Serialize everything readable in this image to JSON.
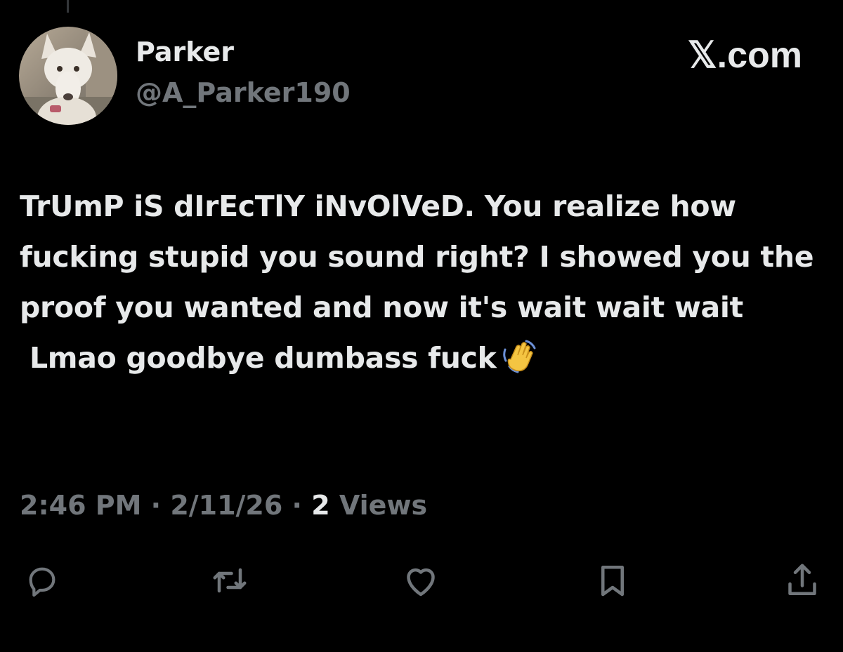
{
  "author": {
    "display_name": "Parker",
    "handle": "@A_Parker190"
  },
  "brand": {
    "text": "𝕏.com"
  },
  "tweet": {
    "text": "TrUmP iS dIrEcTlY iNvOlVeD. You realize how fucking stupid you sound right? I showed you the proof you wanted and now it's wait wait wait\n Lmao goodbye dumbass fuck",
    "emoji": "waving-hand"
  },
  "meta": {
    "time": "2:46 PM",
    "separator": " · ",
    "date": "2/11/26",
    "views_count": "2",
    "views_label": " Views"
  },
  "actions": {
    "icons": [
      "reply-icon",
      "retweet-icon",
      "like-icon",
      "bookmark-icon",
      "share-icon"
    ]
  },
  "colors": {
    "background": "#000000",
    "primary_text": "#e7e9ea",
    "secondary_text": "#71767b"
  }
}
